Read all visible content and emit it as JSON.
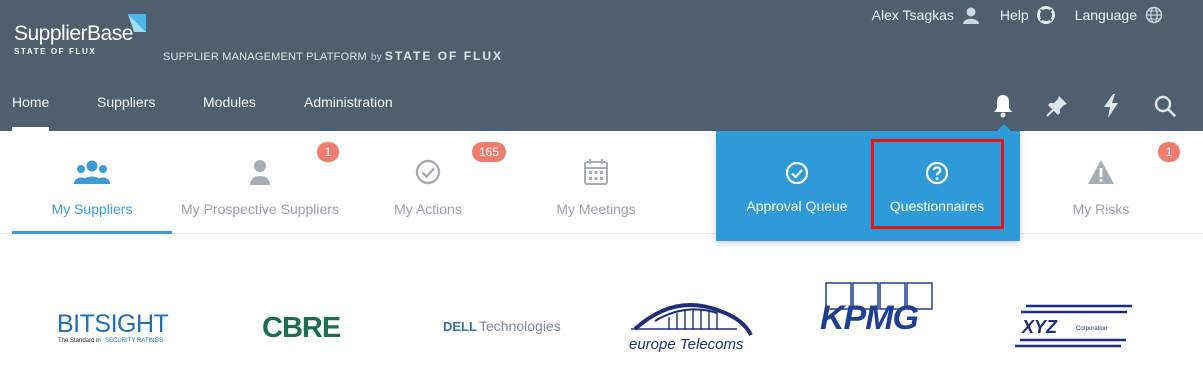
{
  "brand": {
    "name": "SupplierBase",
    "sub": "STATE OF FLUX"
  },
  "tagline": {
    "text": "SUPPLIER MANAGEMENT PLATFORM",
    "by": "by",
    "sof": "STATE OF FLUX"
  },
  "util": {
    "user": "Alex Tsagkas",
    "help": "Help",
    "language": "Language"
  },
  "nav": {
    "items": [
      "Home",
      "Suppliers",
      "Modules",
      "Administration"
    ]
  },
  "tabs": [
    {
      "label": "My Suppliers",
      "icon": "users-icon",
      "badge": ""
    },
    {
      "label": "My Prospective Suppliers",
      "icon": "user-icon",
      "badge": "1"
    },
    {
      "label": "My Actions",
      "icon": "check-circle-icon",
      "badge": "165"
    },
    {
      "label": "My Meetings",
      "icon": "calendar-icon",
      "badge": ""
    },
    {
      "label": "My Risks",
      "icon": "warning-icon",
      "badge": "1"
    }
  ],
  "dropdown": {
    "items": [
      {
        "label": "Approval Queue",
        "icon": "check-circle-icon"
      },
      {
        "label": "Questionnaires",
        "icon": "question-circle-icon"
      }
    ]
  },
  "logos": [
    {
      "name": "BITSIGHT",
      "tagline": "The Standard in",
      "tagline2": "SECURITY RATINGS"
    },
    {
      "name": "CBRE"
    },
    {
      "name": "DELL",
      "suffix": "Technologies"
    },
    {
      "name": "europe Telecoms"
    },
    {
      "name": "KPMG"
    },
    {
      "name": "XYZ",
      "suffix": "Corporation"
    }
  ],
  "colors": {
    "header": "#4f5f70",
    "accent": "#2f9ad8",
    "badge": "#f07b6f",
    "highlight": "#e8141c"
  }
}
